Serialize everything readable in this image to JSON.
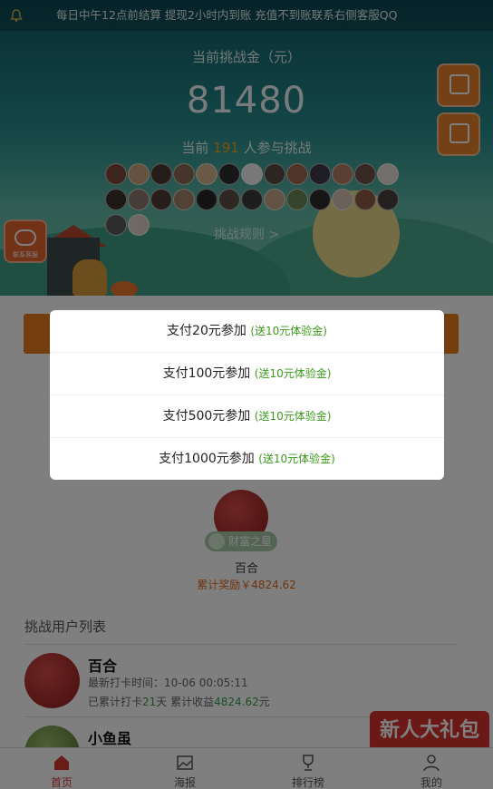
{
  "marquee": "每日中午12点前结算 提现2小时内到账 充值不到账联系右侧客服QQ",
  "hero": {
    "pool_label": "当前挑战金（元）",
    "pool_value": "81480",
    "participants_prefix": "当前",
    "participants_count": "191",
    "participants_suffix": "人参与挑战",
    "rules_link": "挑战规则 >"
  },
  "side_buttons": {
    "kefu_caption": "联系客服"
  },
  "modal": {
    "options": [
      {
        "label": "支付20元参加",
        "bonus": "(送10元体验金)"
      },
      {
        "label": "支付100元参加",
        "bonus": "(送10元体验金)"
      },
      {
        "label": "支付500元参加",
        "bonus": "(送10元体验金)"
      },
      {
        "label": "支付1000元参加",
        "bonus": "(送10元体验金)"
      }
    ]
  },
  "champion": {
    "badge": "财富之星",
    "name": "百合",
    "reward": "累计奖励￥4824.62"
  },
  "list": {
    "title": "挑战用户列表",
    "rows": [
      {
        "name": "百合",
        "checkin_label": "最新打卡时间：",
        "checkin_time": "10-06 00:05:11",
        "days_prefix": "已累计打卡",
        "days": "21",
        "days_unit": "天",
        "income_label": "累计收益",
        "income": "4824.62",
        "income_unit": "元"
      },
      {
        "name": "小鱼虽"
      }
    ]
  },
  "gift_banner": "新人大礼包",
  "tabs": [
    {
      "label": "首页",
      "icon": "home-icon",
      "active": true
    },
    {
      "label": "海报",
      "icon": "poster-icon",
      "active": false
    },
    {
      "label": "排行榜",
      "icon": "trophy-icon",
      "active": false
    },
    {
      "label": "我的",
      "icon": "user-icon",
      "active": false
    }
  ],
  "colors": {
    "accent": "#e77a1a",
    "bonus_green": "#3a9a1a",
    "active_tab": "#d23a2f"
  }
}
